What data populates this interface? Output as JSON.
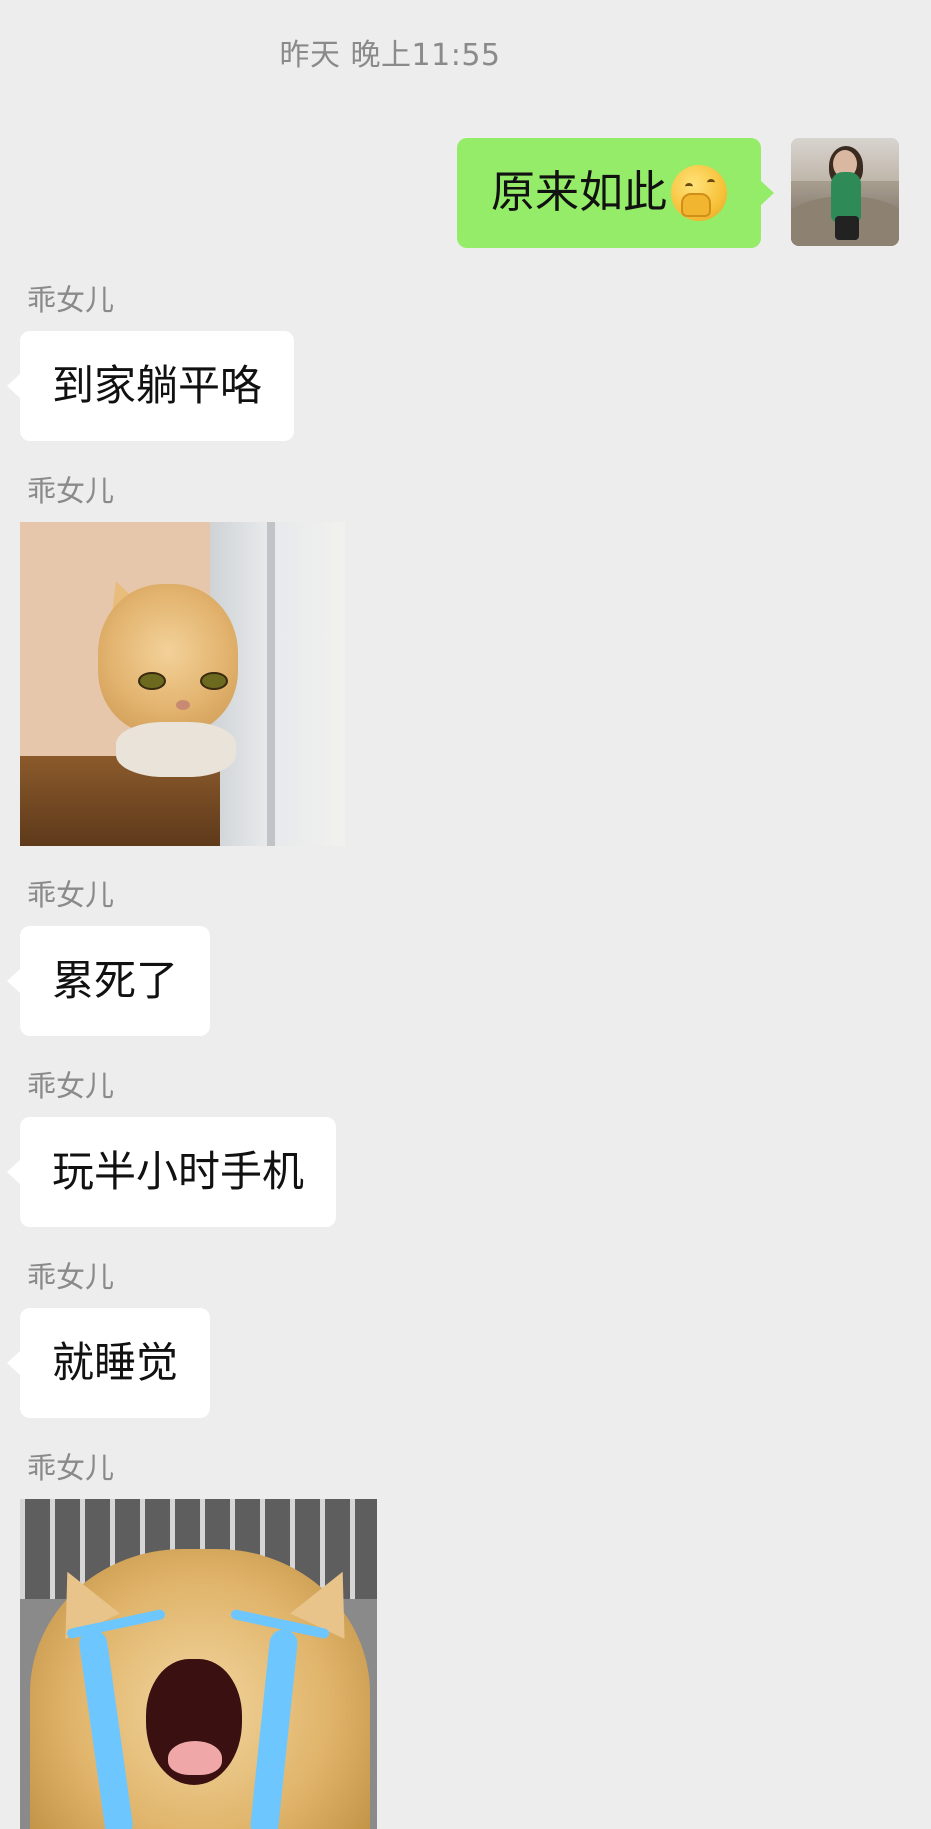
{
  "chat": {
    "timestamp": "昨天 晚上11:55",
    "outgoing": {
      "text": "原来如此",
      "emoji": "shushing-face-emoji"
    },
    "incoming": [
      {
        "sender": "乖女儿",
        "type": "text",
        "text": "到家躺平咯"
      },
      {
        "sender": "乖女儿",
        "type": "sticker",
        "sticker": "cat-peeking-sticker"
      },
      {
        "sender": "乖女儿",
        "type": "text",
        "text": "累死了"
      },
      {
        "sender": "乖女儿",
        "type": "text",
        "text": "玩半小时手机"
      },
      {
        "sender": "乖女儿",
        "type": "text",
        "text": "就睡觉"
      },
      {
        "sender": "乖女儿",
        "type": "sticker",
        "sticker": "crying-cat-sticker"
      }
    ]
  },
  "colors": {
    "background": "#ededed",
    "outgoing_bubble": "#95ec69",
    "incoming_bubble": "#ffffff",
    "meta_text": "#8a8a8a"
  }
}
